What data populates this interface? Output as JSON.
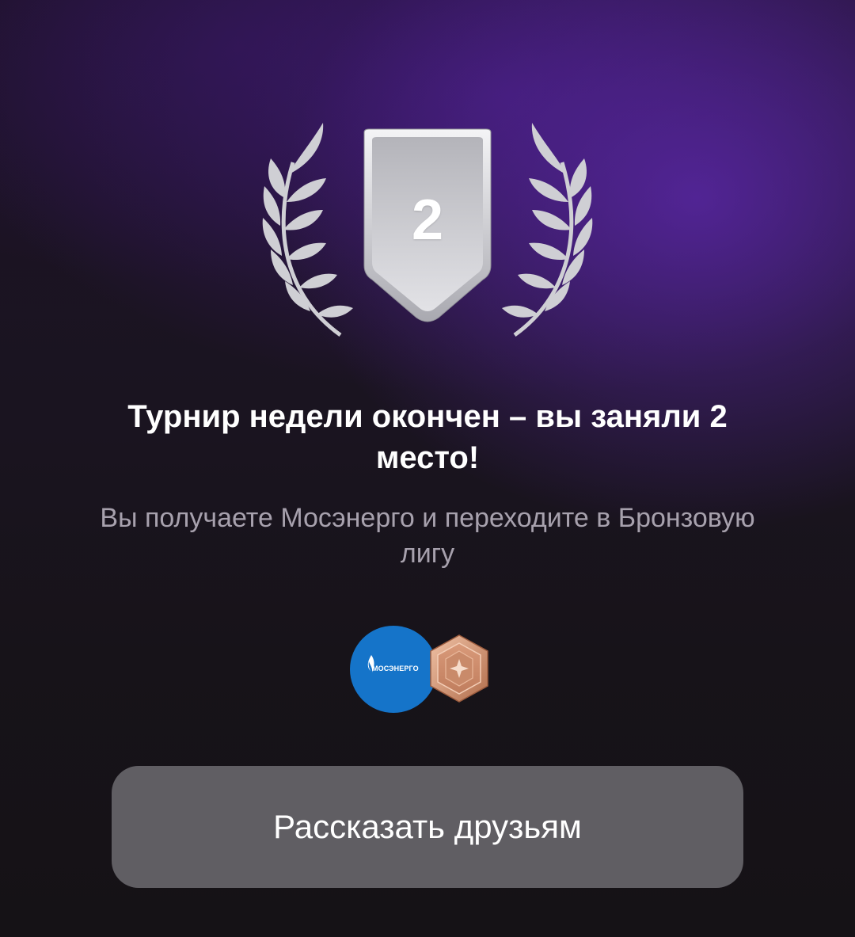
{
  "result": {
    "place": "2",
    "title": "Турнир недели окончен – вы заняли 2 место!",
    "subtitle": "Вы получаете Мосэнерго и переходите в Бронзовую лигу"
  },
  "rewards": {
    "sponsor_logo_text": "МОСЭНЕРГО",
    "sponsor_logo_icon": "mosenergo-logo",
    "league_badge_icon": "bronze-league-badge-icon"
  },
  "actions": {
    "share_label": "Рассказать друзьям"
  },
  "colors": {
    "accent_purple": "#5c28aa",
    "background": "#171319",
    "button_bg": "#605e63",
    "silver": "#c9c9ce",
    "sponsor_blue": "#1574c9",
    "bronze": "#c98a6a"
  }
}
